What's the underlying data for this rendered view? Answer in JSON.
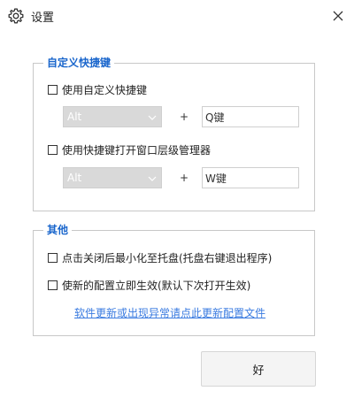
{
  "window": {
    "title": "设置",
    "title_icon": "gear-icon",
    "close_icon": "close-icon"
  },
  "shortcuts_group": {
    "title": "自定义快捷键",
    "custom_shortcut_checkbox": {
      "label": "使用自定义快捷键",
      "checked": false
    },
    "custom_shortcut_modifier": "Alt",
    "custom_shortcut_plus": "+",
    "custom_shortcut_key": "Q键",
    "window_manager_checkbox": {
      "label": "使用快捷键打开窗口层级管理器",
      "checked": false
    },
    "window_manager_modifier": "Alt",
    "window_manager_plus": "+",
    "window_manager_key": "W键"
  },
  "other_group": {
    "title": "其他",
    "minimize_to_tray_checkbox": {
      "label": "点击关闭后最小化至托盘(托盘右键退出程序)",
      "checked": false
    },
    "apply_config_checkbox": {
      "label": "使新的配置立即生效(默认下次打开生效)",
      "checked": false
    },
    "update_config_link": "软件更新或出现异常请点此更新配置文件"
  },
  "ok_button": "好",
  "colors": {
    "group_title": "#1a66cc",
    "link": "#3a7be0",
    "select_bg": "#d9d9d9"
  }
}
